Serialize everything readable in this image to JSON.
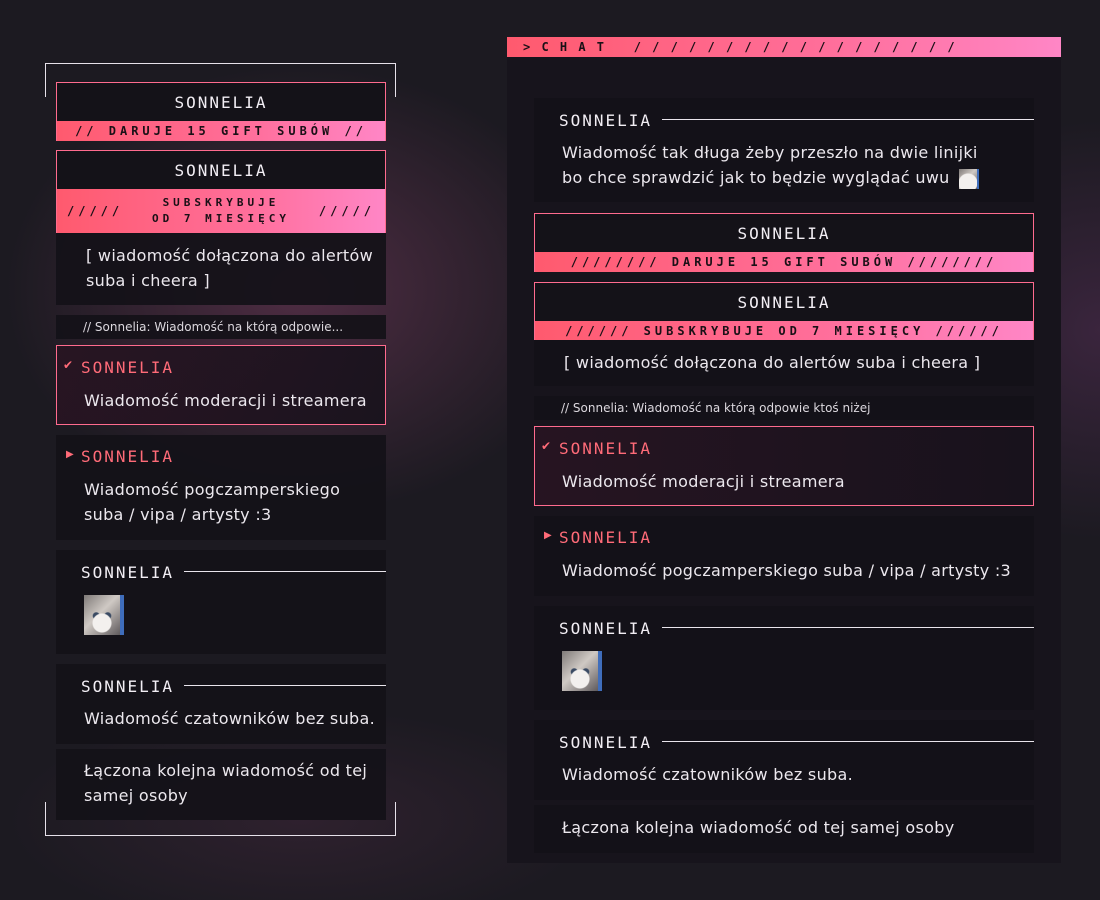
{
  "left": {
    "gift": {
      "name": "SONNELIA",
      "banner": "// DARUJE 15 GIFT SUBÓW //"
    },
    "sub": {
      "name": "SONNELIA",
      "slashes_left": "/////",
      "line1": "SUBSKRYBUJE",
      "line2": "OD 7 MIESIĘCY",
      "slashes_right": "/////",
      "message": "[ wiadomość dołączona do alertów suba i cheera ]"
    },
    "reply": "// Sonnelia: Wiadomość na którą odpowie...",
    "mod": {
      "icon": "sword-icon",
      "name": "SONNELIA",
      "message": "Wiadomość moderacji i streamera"
    },
    "vip": {
      "icon": "play-icon",
      "name": "SONNELIA",
      "message": "Wiadomość pogczamperskiego suba / vipa / artysty :3"
    },
    "emote_msg": {
      "name": "SONNELIA",
      "emote": "kitten-emote"
    },
    "chatter": {
      "name": "SONNELIA",
      "message": "Wiadomość czatowników bez suba."
    },
    "followup": {
      "message": "Łączona kolejna wiadomość od tej samej osoby"
    }
  },
  "right": {
    "header": "> C H A T   / / / / / / / / / / / / / / / / / /",
    "long": {
      "name": "SONNELIA",
      "message": "Wiadomość tak długa żeby przeszło na dwie linijki bo chce sprawdzić jak to będzie wyglądać uwu",
      "emote": "kitten-emote"
    },
    "gift": {
      "name": "SONNELIA",
      "banner": "//////// DARUJE 15 GIFT SUBÓW ////////"
    },
    "sub": {
      "name": "SONNELIA",
      "banner": "////// SUBSKRYBUJE OD 7 MIESIĘCY //////",
      "message": "[ wiadomość dołączona do alertów suba i cheera ]"
    },
    "reply": "// Sonnelia: Wiadomość na którą odpowie ktoś niżej",
    "mod": {
      "icon": "sword-icon",
      "name": "SONNELIA",
      "message": "Wiadomość moderacji i streamera"
    },
    "vip": {
      "icon": "play-icon",
      "name": "SONNELIA",
      "message": "Wiadomość pogczamperskiego suba / vipa / artysty :3"
    },
    "emote_msg": {
      "name": "SONNELIA",
      "emote": "kitten-emote"
    },
    "chatter": {
      "name": "SONNELIA",
      "message": "Wiadomość czatowników bez suba."
    },
    "followup": {
      "message": "Łączona kolejna wiadomość od tej samej osoby"
    }
  },
  "colors": {
    "accent": "#ff6b78",
    "banner_start": "#ff5a6e",
    "banner_end": "#ff86c6",
    "card": "#141218",
    "background": "#1c1a21"
  }
}
